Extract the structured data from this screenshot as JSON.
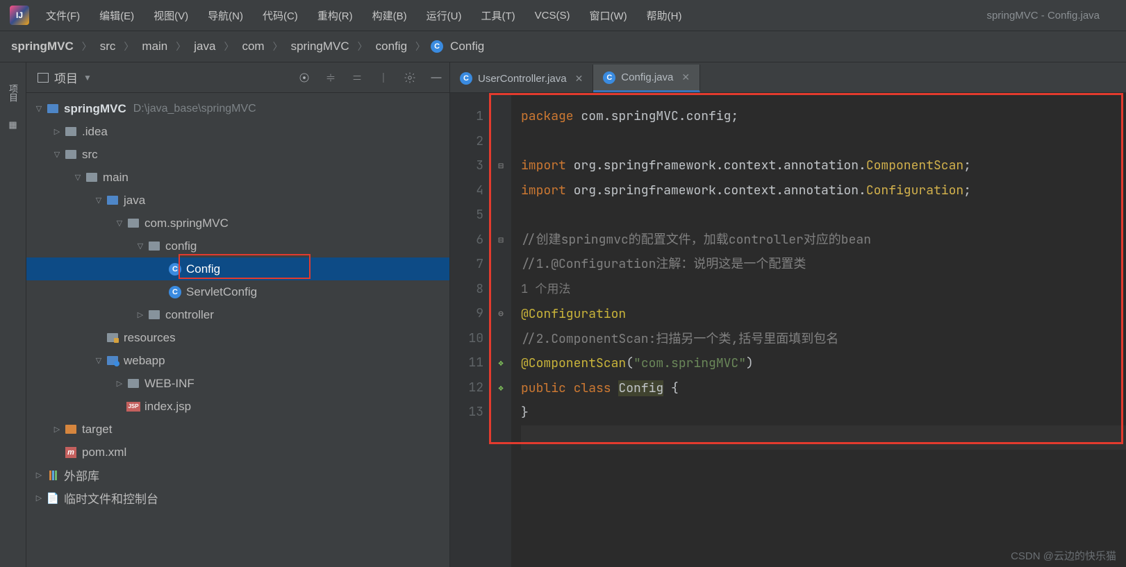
{
  "menu": {
    "items": [
      "文件(F)",
      "编辑(E)",
      "视图(V)",
      "导航(N)",
      "代码(C)",
      "重构(R)",
      "构建(B)",
      "运行(U)",
      "工具(T)",
      "VCS(S)",
      "窗口(W)",
      "帮助(H)"
    ],
    "window_title": "springMVC - Config.java"
  },
  "breadcrumb": [
    "springMVC",
    "src",
    "main",
    "java",
    "com",
    "springMVC",
    "config",
    "Config"
  ],
  "sidebar": {
    "title": "项目",
    "root": {
      "name": "springMVC",
      "path": "D:\\java_base\\springMVC"
    },
    "nodes": {
      "idea": ".idea",
      "src": "src",
      "main": "main",
      "java": "java",
      "pkg": "com.springMVC",
      "config_pkg": "config",
      "config_cls": "Config",
      "servlet_cls": "ServletConfig",
      "controller": "controller",
      "resources": "resources",
      "webapp": "webapp",
      "webinf": "WEB-INF",
      "indexjsp": "index.jsp",
      "target": "target",
      "pom": "pom.xml",
      "ext_lib": "外部库",
      "scratch": "临时文件和控制台"
    }
  },
  "tabs": {
    "t1": "UserController.java",
    "t2": "Config.java"
  },
  "code": {
    "l1_kw": "package",
    "l1_rest": " com.springMVC.config;",
    "l3_kw": "import",
    "l3_rest": " org.springframework.context.annotation.",
    "l3_cls": "ComponentScan",
    "l3_semi": ";",
    "l4_kw": "import",
    "l4_rest": " org.springframework.context.annotation.",
    "l4_cls": "Configuration",
    "l4_semi": ";",
    "l6": "//创建springmvc的配置文件，加载controller对应的bean",
    "l7": "//1.@Configuration注解：说明这是一个配置类",
    "hint": "1 个用法",
    "l8": "@Configuration",
    "l9": "//2.ComponentScan:扫描另一个类,括号里面填到包名",
    "l10_a": "@ComponentScan",
    "l10_p": "(",
    "l10_s": "\"com.springMVC\"",
    "l10_e": ")",
    "l11_a": "public ",
    "l11_b": "class ",
    "l11_c": "Config",
    "l11_d": " {",
    "l12": "}",
    "line_numbers": [
      "1",
      "2",
      "3",
      "4",
      "5",
      "6",
      "7",
      "",
      "8",
      "9",
      "10",
      "11",
      "12",
      "13"
    ]
  },
  "watermark": "CSDN @云边的快乐猫"
}
